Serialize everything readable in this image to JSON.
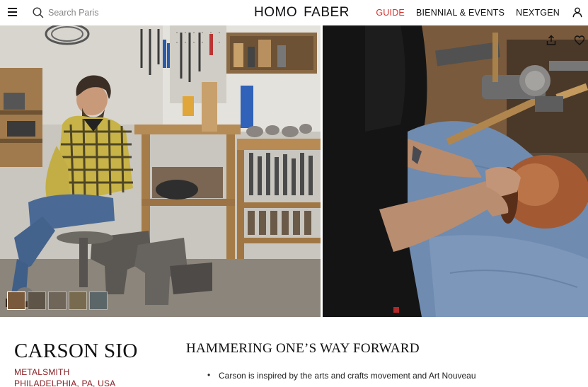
{
  "header": {
    "search_placeholder": "Search Paris",
    "logo_left": "HOMO",
    "logo_right": "FABER",
    "nav": [
      {
        "label": "GUIDE",
        "active": true
      },
      {
        "label": "BIENNIAL & EVENTS",
        "active": false
      },
      {
        "label": "NEXTGEN",
        "active": false
      }
    ],
    "icons": [
      "menu-icon",
      "search-icon",
      "user-icon"
    ],
    "accent_color": "#d4302b"
  },
  "gallery": {
    "icons": [
      "share-icon",
      "heart-icon"
    ],
    "thumbnail_count": 5,
    "active_thumbnail": 1
  },
  "artisan": {
    "name": "CARSON SIO",
    "profession": "METALSMITH",
    "location": "PHILADELPHIA, PA, USA",
    "label_color": "#8a1f24"
  },
  "article": {
    "title": "HAMMERING ONE’S WAY FORWARD",
    "bullets": [
      "Carson is inspired by the arts and crafts movement and Art Nouveau"
    ]
  }
}
